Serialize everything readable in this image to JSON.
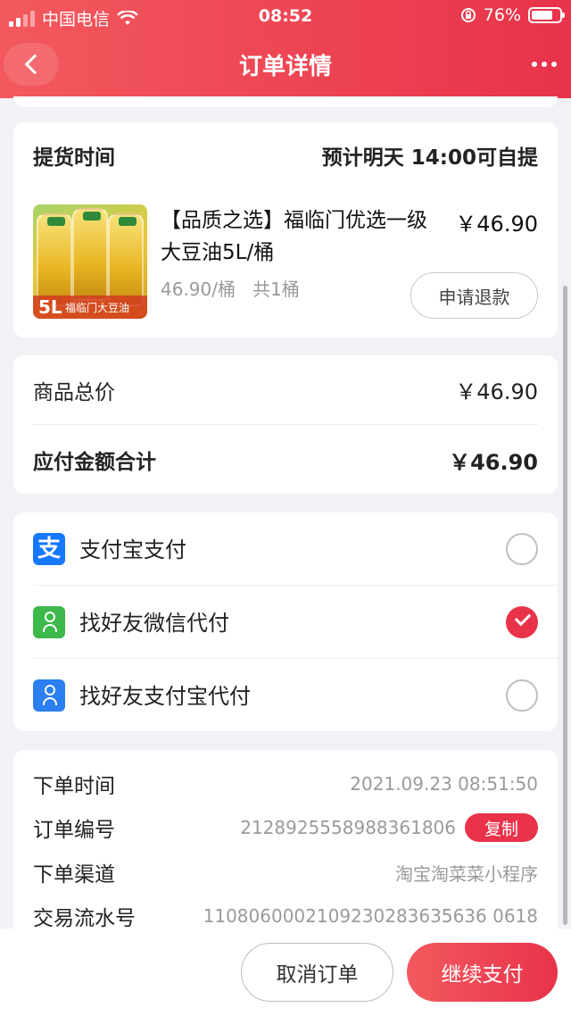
{
  "status_bar": {
    "carrier": "中国电信",
    "time": "08:52",
    "battery": "76%",
    "battery_level": 0.76
  },
  "header": {
    "title": "订单详情"
  },
  "pickup": {
    "label": "提货时间",
    "value": "预计明天 14:00可自提"
  },
  "product": {
    "title": "【品质之选】福临门优选一级大豆油5L/桶",
    "price": "￥46.90",
    "unit_info": "46.90/桶   共1桶",
    "refund_label": "申请退款",
    "image_text": {
      "size": "5L",
      "brand": "福临门大豆油"
    }
  },
  "prices": [
    {
      "label": "商品总价",
      "value": "￥46.90"
    },
    {
      "label": "应付金额合计",
      "value": "￥46.90"
    }
  ],
  "payment_methods": [
    {
      "label": "支付宝支付",
      "icon": "alipay-icon",
      "icon_glyph": "支",
      "selected": false
    },
    {
      "label": "找好友微信代付",
      "icon": "wechat-friend-icon",
      "selected": true
    },
    {
      "label": "找好友支付宝代付",
      "icon": "alipay-friend-icon",
      "selected": false
    }
  ],
  "order_info": [
    {
      "label": "下单时间",
      "value": "2021.09.23 08:51:50"
    },
    {
      "label": "订单编号",
      "value": "2128925558988361806",
      "action": "复制"
    },
    {
      "label": "下单渠道",
      "value": "淘宝淘菜菜小程序"
    },
    {
      "label": "交易流水号",
      "value": "1108060002109230283635636 0618"
    }
  ],
  "actions": {
    "cancel": "取消订单",
    "continue": "继续支付"
  },
  "colors": {
    "accent": "#e8334a",
    "accent_light": "#f3595e",
    "background": "#f1f2f6",
    "alipay": "#1677ff",
    "wechat": "#3cb94a"
  }
}
